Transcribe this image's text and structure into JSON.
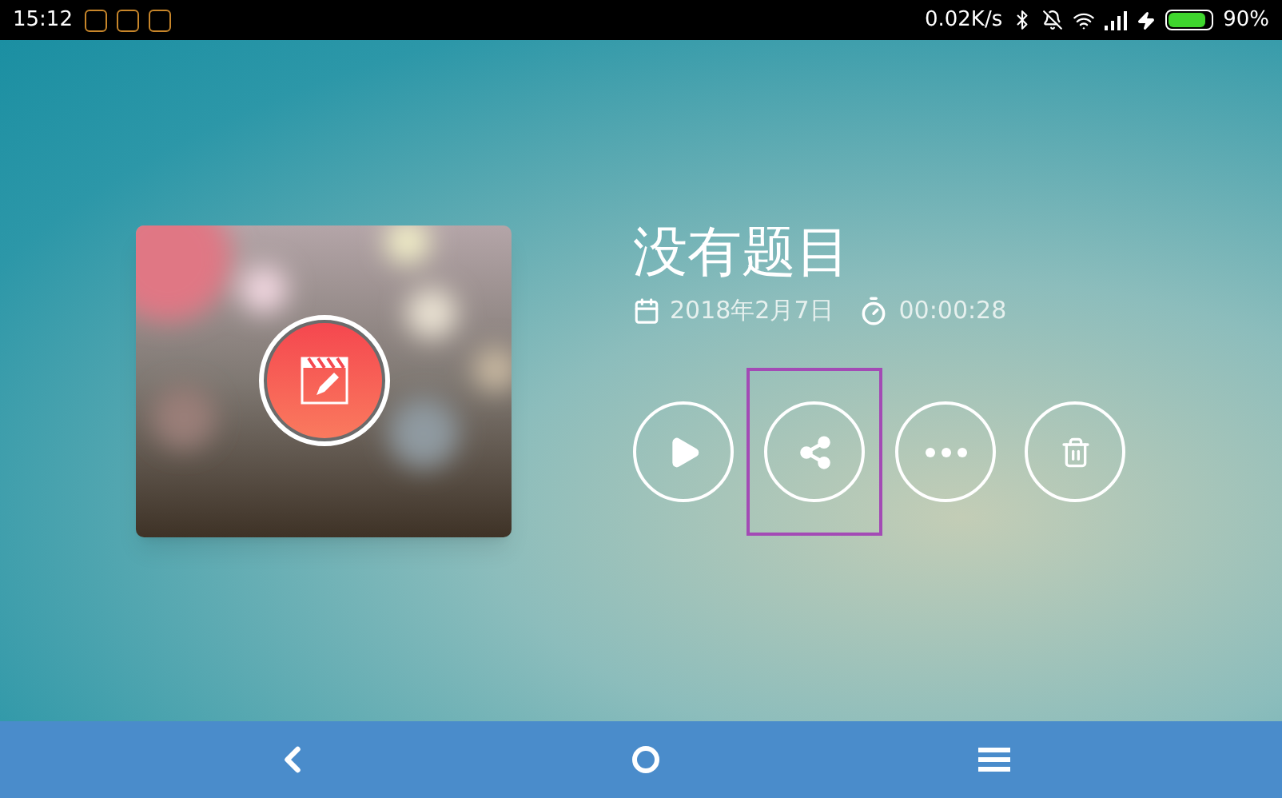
{
  "status_bar": {
    "time": "15:12",
    "speed": "0.02K/s",
    "battery": {
      "level": 0.9
    },
    "battery_text": "90%"
  },
  "recording": {
    "title": "没有题目",
    "date": "2018年2月7日",
    "duration": "00:00:28"
  },
  "actions": [
    {
      "kind": "play",
      "highlighted": false
    },
    {
      "kind": "share",
      "highlighted": true
    },
    {
      "kind": "more",
      "highlighted": false
    },
    {
      "kind": "delete",
      "highlighted": false
    }
  ]
}
